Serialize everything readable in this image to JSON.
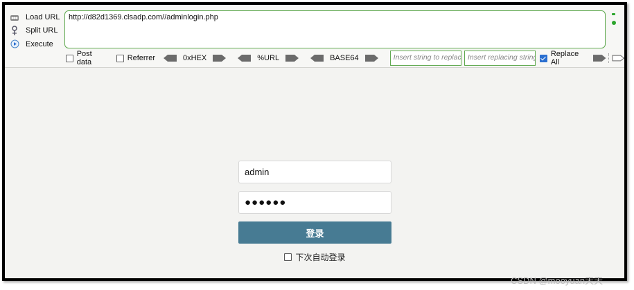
{
  "hackbar": {
    "menu": {
      "load_url": "Load URL",
      "split_url": "Split URL",
      "execute": "Execute"
    },
    "url_value": "http://d82d1369.clsadp.com//adminlogin.php",
    "options": {
      "post_data": "Post data",
      "referrer": "Referrer",
      "hex": "0xHEX",
      "url": "%URL",
      "base64": "BASE64",
      "find_placeholder": "Insert string to replace",
      "replace_placeholder": "Insert replacing string",
      "replace_all": "Replace All",
      "replace_all_checked": true
    }
  },
  "login": {
    "username": "admin",
    "password_mask": "●●●●●●",
    "submit_label": "登录",
    "remember_label": "下次自动登录"
  },
  "watermark": "CSDN @mooyuan天天"
}
